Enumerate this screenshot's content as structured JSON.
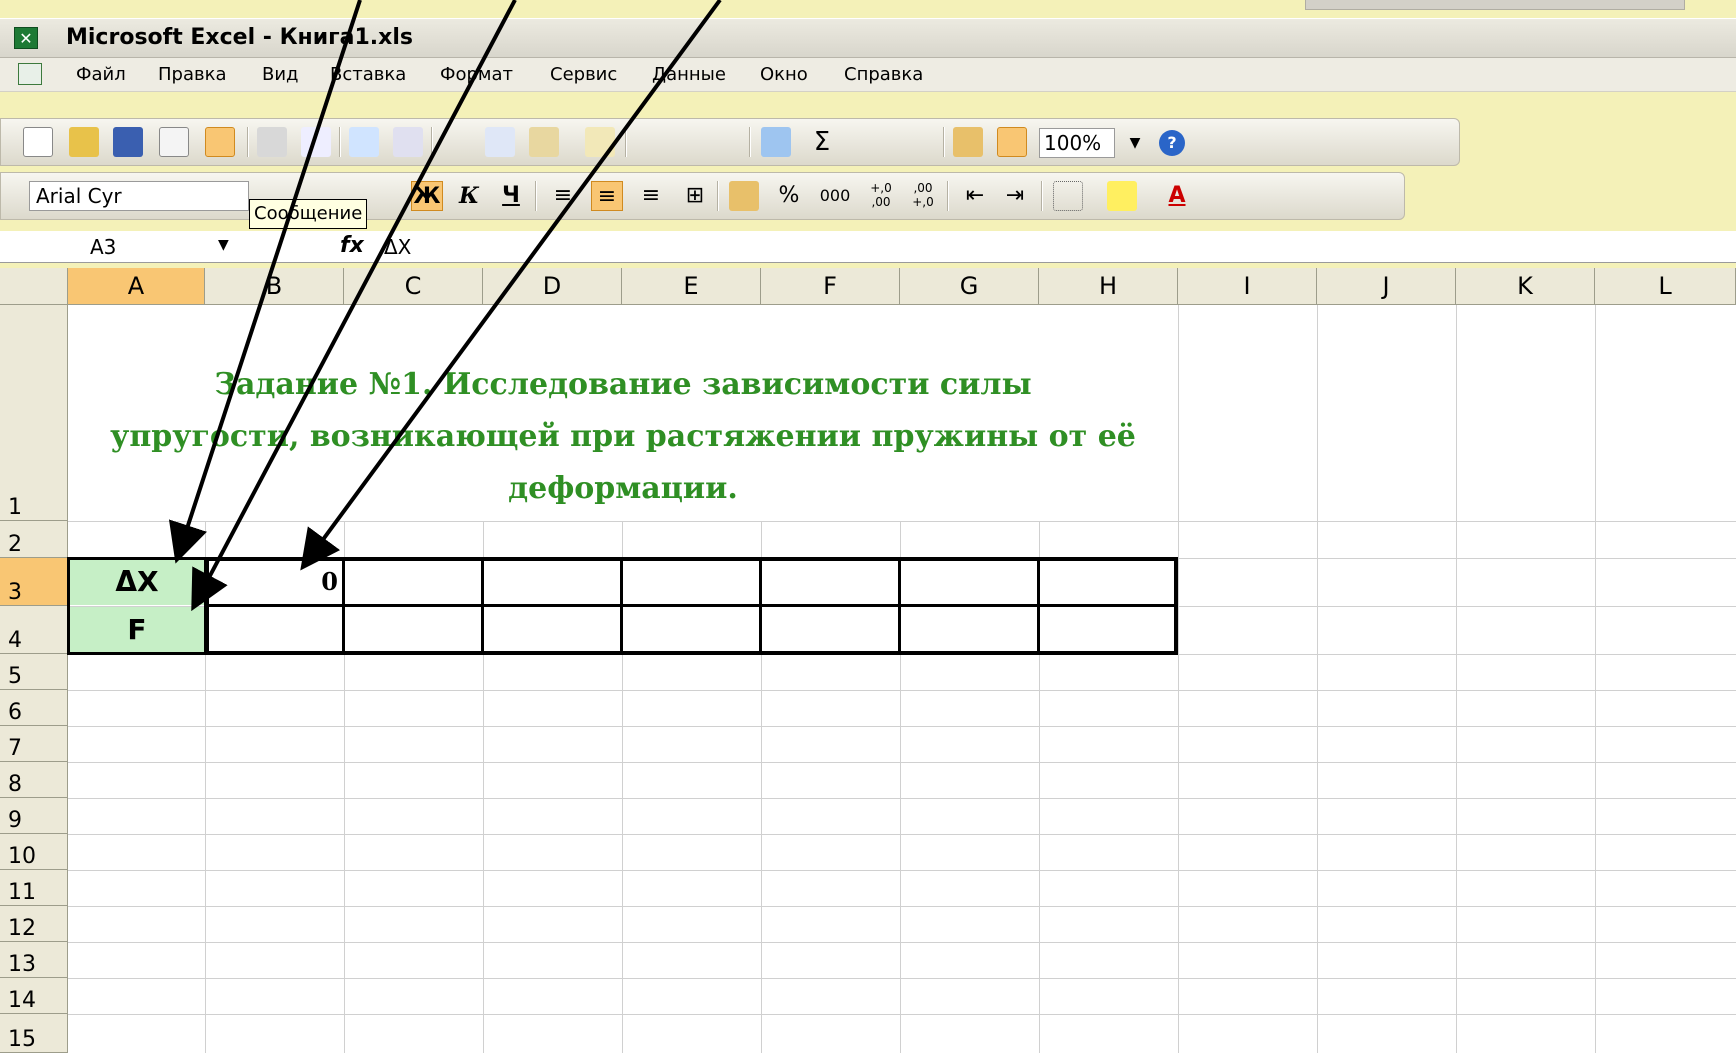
{
  "window": {
    "title": "Microsoft Excel - Книга1.xls"
  },
  "menu": [
    "Файл",
    "Правка",
    "Вид",
    "Вставка",
    "Формат",
    "Сервис",
    "Данные",
    "Окно",
    "Справка"
  ],
  "toolbar": {
    "zoom": "100%",
    "tooltip": "Сообщение"
  },
  "format_toolbar": {
    "font": "Arial Cyr",
    "bold": "Ж",
    "italic": "К",
    "underline": "Ч",
    "percent": "%",
    "thousands": "000",
    "inc_decimal": "+,0 ,00",
    "dec_decimal": ",00 +,0"
  },
  "formula_bar": {
    "name_box": "A3",
    "fx": "fx",
    "content": "ΔX"
  },
  "columns": [
    "A",
    "B",
    "C",
    "D",
    "E",
    "F",
    "G",
    "H",
    "I",
    "J",
    "K",
    "L"
  ],
  "rows": [
    "1",
    "2",
    "3",
    "4",
    "5",
    "6",
    "7",
    "8",
    "9",
    "10",
    "11",
    "12",
    "13",
    "14",
    "15"
  ],
  "sheet": {
    "title_lines": [
      "Задание №1.  Исследование зависимости силы",
      "упругости, возникающей при растяжении пружины от её",
      "деформации."
    ],
    "a3": "ΔX",
    "a4": "F",
    "b3": "0"
  },
  "colors": {
    "title_green": "#2f8f24",
    "label_fill": "#c6efc6",
    "active_header": "#f9c673"
  }
}
